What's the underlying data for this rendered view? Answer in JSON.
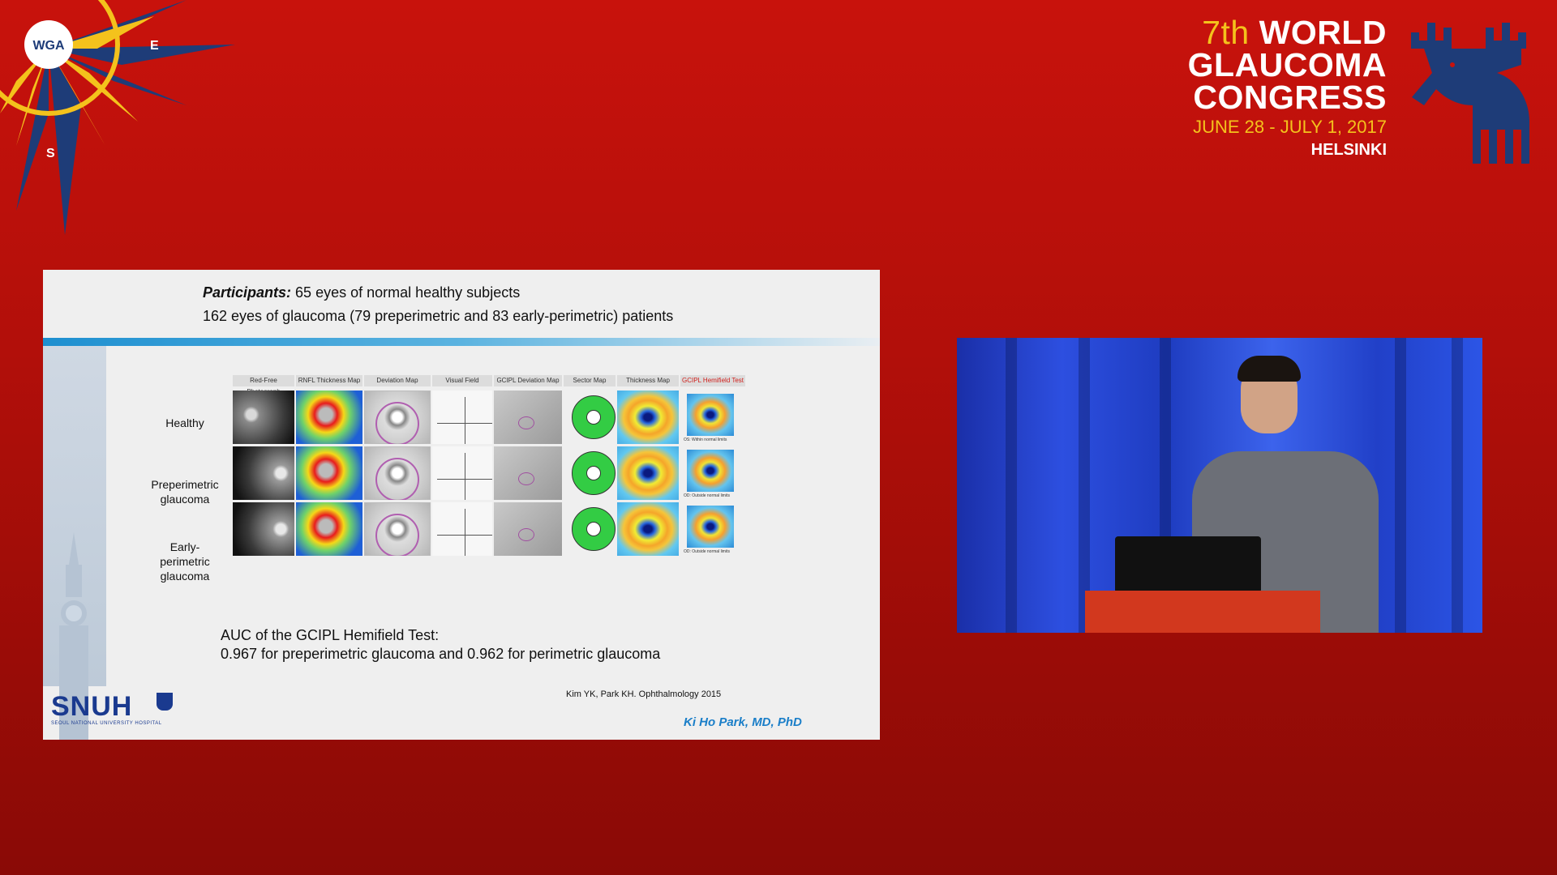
{
  "wga_logo": {
    "name": "WGA",
    "letters": [
      "E",
      "S"
    ]
  },
  "branding": {
    "ordinal": "7th",
    "word1": "WORLD",
    "word2": "GLAUCOMA",
    "word3": "CONGRESS",
    "dates": "JUNE 28 - JULY 1, 2017",
    "city": "HELSINKI"
  },
  "slide": {
    "participants_label": "Participants:",
    "participants_text": "65 eyes of normal healthy subjects",
    "participants_line2": "162 eyes of glaucoma (79 preperimetric and 83 early-perimetric) patients",
    "column_headers": [
      "Red-Free Photograph",
      "RNFL Thickness Map",
      "Deviation Map",
      "Visual Field",
      "GCIPL Deviation Map",
      "Sector Map",
      "Thickness Map",
      "GCIPL Hemifield Test"
    ],
    "row_labels": [
      "Healthy",
      "Preperimetric\nglaucoma",
      "Early-\nperimetric\nglaucoma"
    ],
    "hemifield_notes": [
      "OS: Within normal limits",
      "OD: Outside normal limits",
      "OD: Outside normal limits"
    ],
    "auc_line1": "AUC of the GCIPL Hemifield Test:",
    "auc_line2": "0.967 for preperimetric glaucoma and 0.962 for perimetric glaucoma",
    "reference": "Kim YK, Park KH. Ophthalmology 2015",
    "presenter": "Ki Ho Park, MD, PhD",
    "hospital_logo": "SNUH",
    "hospital_sub": "SEOUL NATIONAL UNIVERSITY HOSPITAL"
  },
  "colors": {
    "background": "#b20f0a",
    "brand_yellow": "#f4c21c",
    "moose_blue": "#1e3c78",
    "accent_blue": "#1a7ec8"
  }
}
